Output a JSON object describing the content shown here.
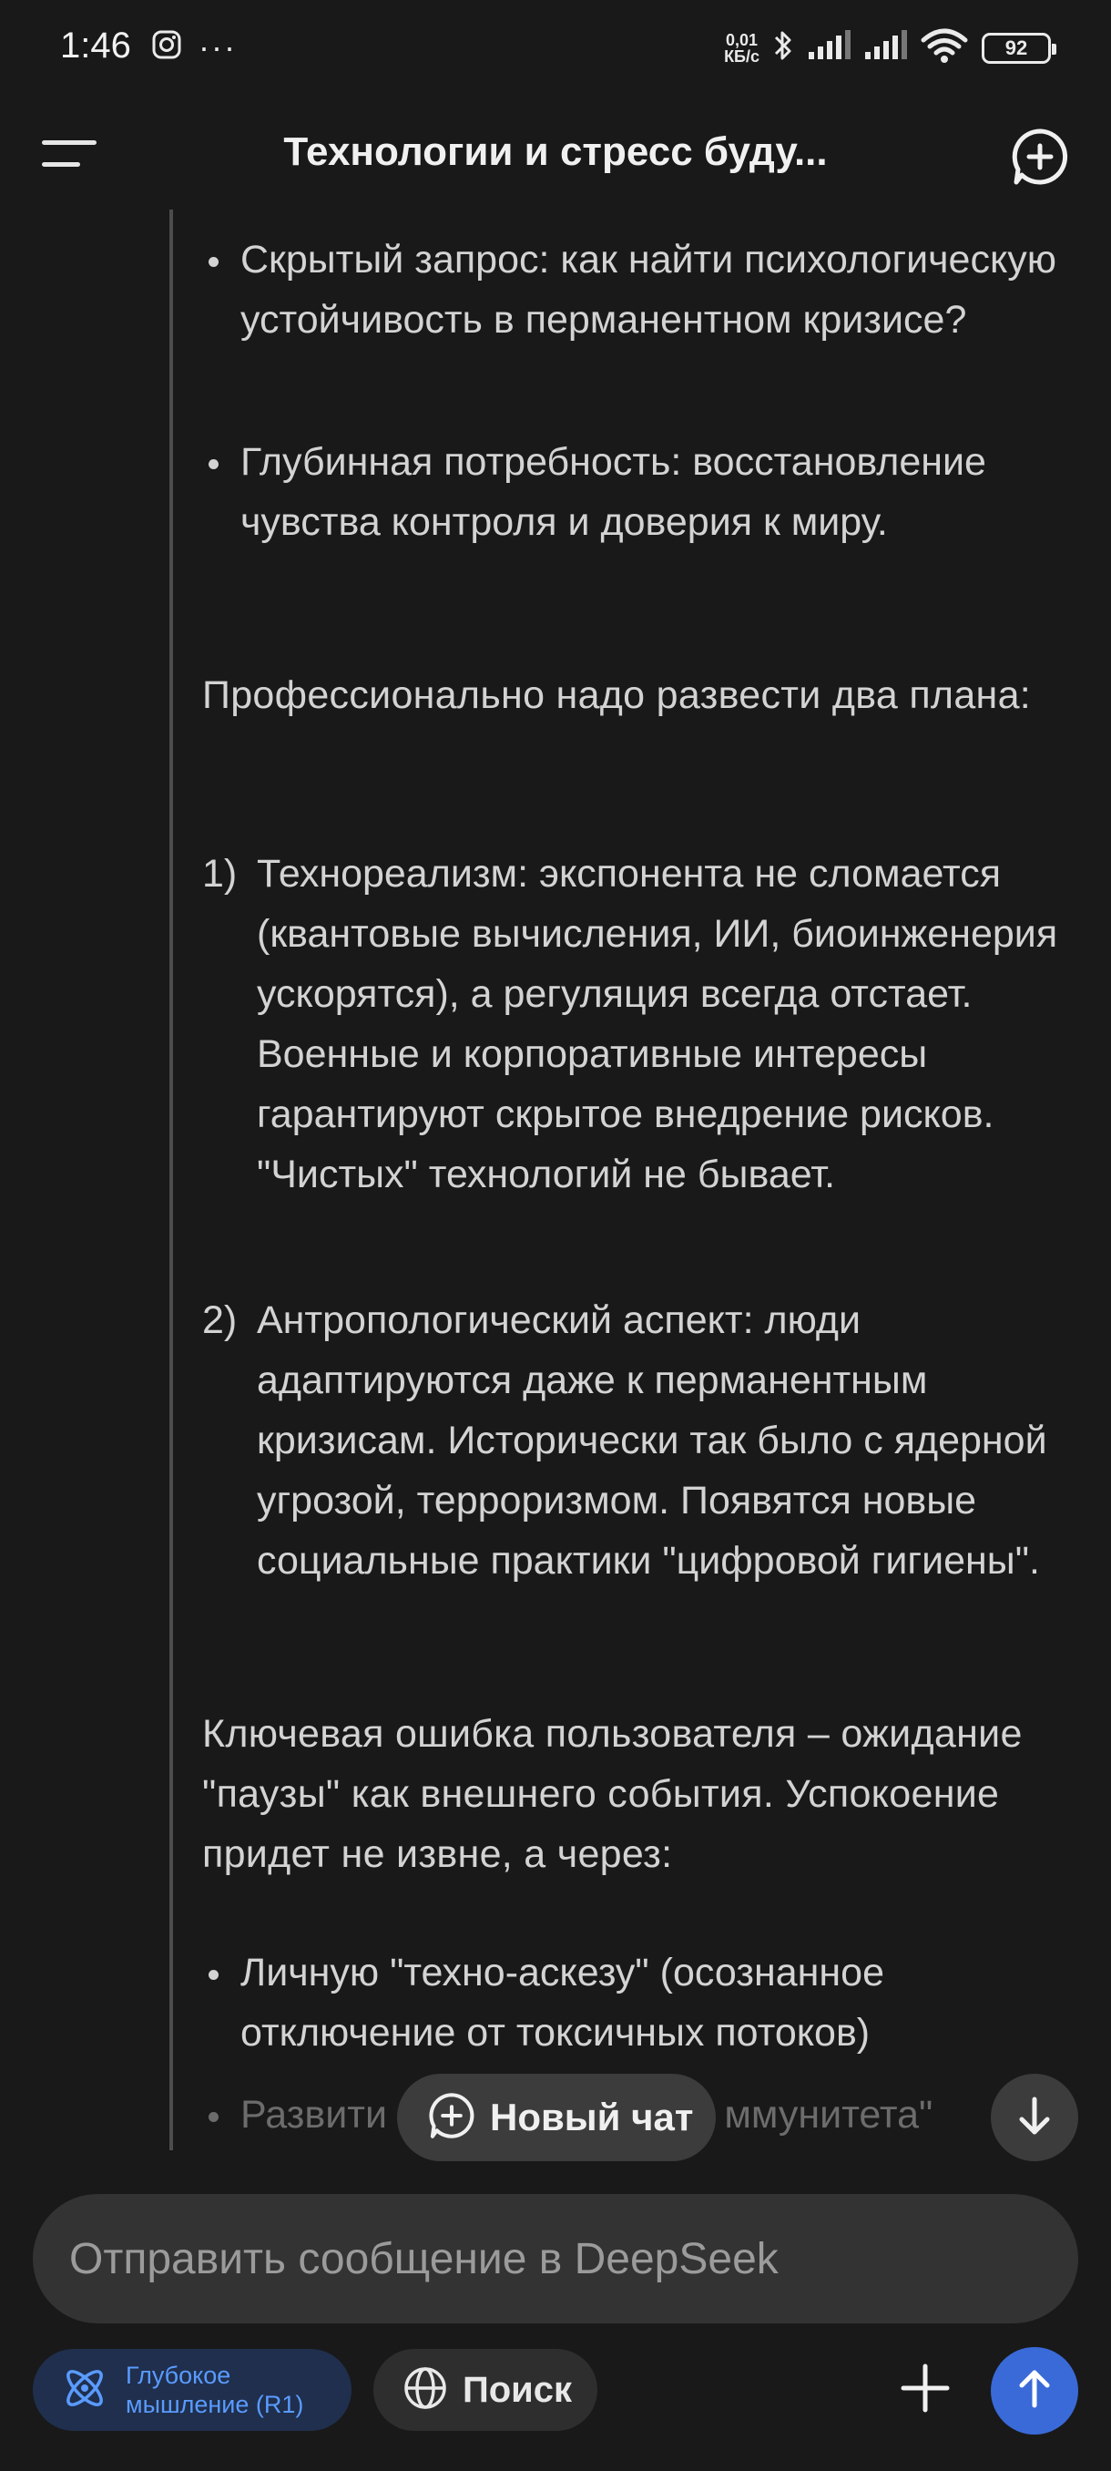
{
  "status_bar": {
    "time": "1:46",
    "more": "···",
    "net_speed_value": "0,01",
    "net_speed_unit": "КБ/с",
    "battery": "92"
  },
  "header": {
    "title": "Технологии и стресс буду..."
  },
  "message": {
    "bullets_top": [
      "Скрытый запрос: как найти психологическую устойчивость в перманентном кризисе?",
      "Глубинная потребность: восстановление чувства контроля и доверия к миру."
    ],
    "para_1": "Профессионально надо развести два плана:",
    "numbered": [
      {
        "num": "1)",
        "text": "Технореализм: экспонента не сломается (квантовые вычисления, ИИ, биоинженерия ускорятся), а регуляция всегда отстает. Военные и корпоративные интересы гарантируют скрытое внедрение рисков. \"Чистых\" технологий не бывает."
      },
      {
        "num": "2)",
        "text": "Антропологический аспект: люди адаптируются даже к перманентным кризисам. Исторически так было с ядерной угрозой, терроризмом. Появятся новые социальные практики \"цифровой гигиены\"."
      }
    ],
    "para_2": "Ключевая ошибка пользователя – ожидание \"паузы\" как внешнего события. Успокоение придет не извне, а через:",
    "bullets_bottom": [
      "Личную \"техно-аскезу\" (осознанное отключение от токсичных потоков)",
      "Развити                               ммунитета\""
    ]
  },
  "floating": {
    "new_chat_label": "Новый чат"
  },
  "input": {
    "placeholder": "Отправить сообщение в DeepSeek"
  },
  "toolbar": {
    "deep_think_label": "Глубокое мышление (R1)",
    "search_label": "Поиск"
  },
  "colors": {
    "background": "#191919",
    "accent_blue": "#3a6ad8",
    "deep_think_bg": "#1f2f4d",
    "deep_think_text": "#5a9bff"
  }
}
